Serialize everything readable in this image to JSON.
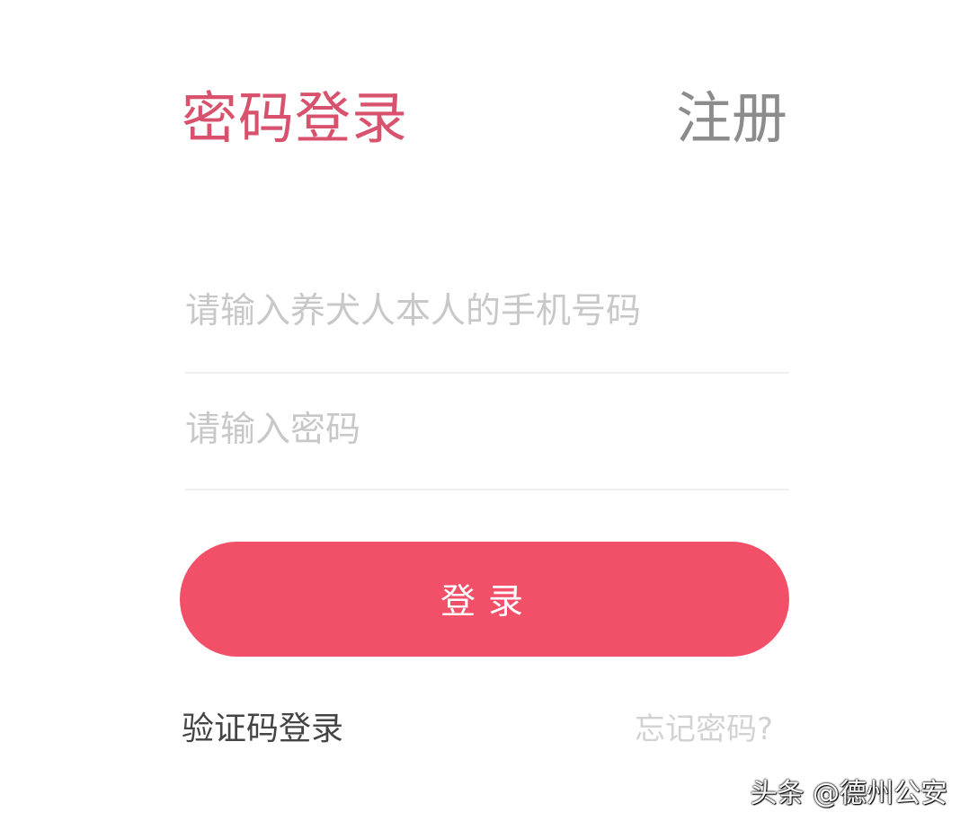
{
  "header": {
    "title": "密码登录",
    "register_label": "注册"
  },
  "form": {
    "phone_placeholder": "请输入养犬人本人的手机号码",
    "password_placeholder": "请输入密码",
    "phone_value": "",
    "password_value": ""
  },
  "actions": {
    "login_label": "登录",
    "sms_login_label": "验证码登录",
    "forgot_password_label": "忘记密码?"
  },
  "watermark": {
    "text": "头条 @德州公安"
  },
  "colors": {
    "accent": "#f25068",
    "title": "#d9526d",
    "register": "#8c8c8c",
    "placeholder": "#c8c8c8"
  }
}
